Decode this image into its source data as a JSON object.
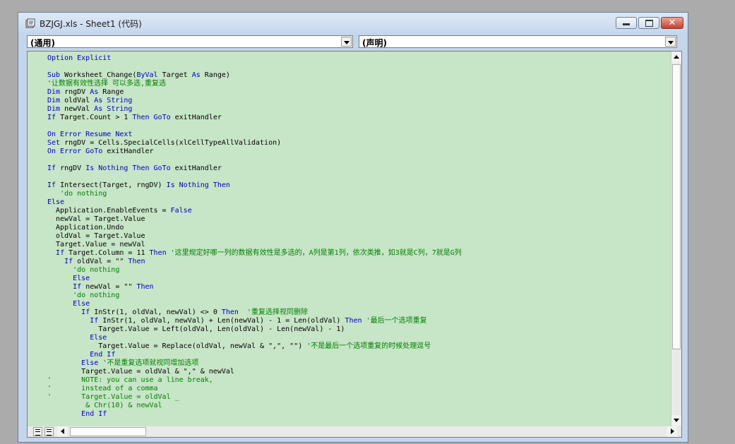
{
  "window": {
    "title": "BZJGJ.xls - Sheet1 (代码)",
    "buttons": {
      "minimize": "minimize-icon",
      "maximize": "maximize-icon",
      "close": "✕"
    }
  },
  "dropdowns": {
    "object": "(通用)",
    "procedure": "(声明)"
  },
  "colors": {
    "code_bg": "#c7e5c7",
    "keyword": "#0000c0",
    "comment": "#008000",
    "chrome": "#c4d6ec"
  },
  "code_lines": [
    [
      {
        "t": "Option Explicit",
        "c": "k"
      }
    ],
    [],
    [
      {
        "t": "Sub",
        "c": "k"
      },
      {
        "t": " Worksheet_Change("
      },
      {
        "t": "ByVal",
        "c": "k"
      },
      {
        "t": " Target "
      },
      {
        "t": "As",
        "c": "k"
      },
      {
        "t": " Range)"
      }
    ],
    [
      {
        "t": "'让数据有效性选择 可以多选,重复选",
        "c": "c"
      }
    ],
    [
      {
        "t": "Dim",
        "c": "k"
      },
      {
        "t": " rngDV "
      },
      {
        "t": "As",
        "c": "k"
      },
      {
        "t": " Range"
      }
    ],
    [
      {
        "t": "Dim",
        "c": "k"
      },
      {
        "t": " oldVal "
      },
      {
        "t": "As String",
        "c": "k"
      }
    ],
    [
      {
        "t": "Dim",
        "c": "k"
      },
      {
        "t": " newVal "
      },
      {
        "t": "As String",
        "c": "k"
      }
    ],
    [
      {
        "t": "If",
        "c": "k"
      },
      {
        "t": " Target.Count > 1 "
      },
      {
        "t": "Then GoTo",
        "c": "k"
      },
      {
        "t": " exitHandler"
      }
    ],
    [],
    [
      {
        "t": "On Error Resume Next",
        "c": "k"
      }
    ],
    [
      {
        "t": "Set",
        "c": "k"
      },
      {
        "t": " rngDV = Cells.SpecialCells(xlCellTypeAllValidation)"
      }
    ],
    [
      {
        "t": "On Error GoTo",
        "c": "k"
      },
      {
        "t": " exitHandler"
      }
    ],
    [],
    [
      {
        "t": "If",
        "c": "k"
      },
      {
        "t": " rngDV "
      },
      {
        "t": "Is Nothing Then GoTo",
        "c": "k"
      },
      {
        "t": " exitHandler"
      }
    ],
    [],
    [
      {
        "t": "If",
        "c": "k"
      },
      {
        "t": " Intersect(Target, rngDV) "
      },
      {
        "t": "Is Nothing Then",
        "c": "k"
      }
    ],
    [
      {
        "t": "   "
      },
      {
        "t": "'do nothing",
        "c": "c"
      }
    ],
    [
      {
        "t": "Else",
        "c": "k"
      }
    ],
    [
      {
        "t": "  Application.EnableEvents = "
      },
      {
        "t": "False",
        "c": "k"
      }
    ],
    [
      {
        "t": "  newVal = Target.Value"
      }
    ],
    [
      {
        "t": "  Application.Undo"
      }
    ],
    [
      {
        "t": "  oldVal = Target.Value"
      }
    ],
    [
      {
        "t": "  Target.Value = newVal"
      }
    ],
    [
      {
        "t": "  "
      },
      {
        "t": "If",
        "c": "k"
      },
      {
        "t": " Target.Column = 11 "
      },
      {
        "t": "Then",
        "c": "k"
      },
      {
        "t": " "
      },
      {
        "t": "'这里规定好哪一列的数据有效性是多选的，A列是第1列，依次类推，如3就是C列，7就是G列",
        "c": "c"
      }
    ],
    [
      {
        "t": "    "
      },
      {
        "t": "If",
        "c": "k"
      },
      {
        "t": " oldVal = \"\" "
      },
      {
        "t": "Then",
        "c": "k"
      }
    ],
    [
      {
        "t": "      "
      },
      {
        "t": "'do nothing",
        "c": "c"
      }
    ],
    [
      {
        "t": "      "
      },
      {
        "t": "Else",
        "c": "k"
      }
    ],
    [
      {
        "t": "      "
      },
      {
        "t": "If",
        "c": "k"
      },
      {
        "t": " newVal = \"\" "
      },
      {
        "t": "Then",
        "c": "k"
      }
    ],
    [
      {
        "t": "      "
      },
      {
        "t": "'do nothing",
        "c": "c"
      }
    ],
    [
      {
        "t": "      "
      },
      {
        "t": "Else",
        "c": "k"
      }
    ],
    [
      {
        "t": "        "
      },
      {
        "t": "If",
        "c": "k"
      },
      {
        "t": " InStr(1, oldVal, newVal) <> 0 "
      },
      {
        "t": "Then",
        "c": "k"
      },
      {
        "t": "  "
      },
      {
        "t": "'重复选择视同删除",
        "c": "c"
      }
    ],
    [
      {
        "t": "          "
      },
      {
        "t": "If",
        "c": "k"
      },
      {
        "t": " InStr(1, oldVal, newVal) + Len(newVal) - 1 = Len(oldVal) "
      },
      {
        "t": "Then",
        "c": "k"
      },
      {
        "t": " "
      },
      {
        "t": "'最后一个选项重复",
        "c": "c"
      }
    ],
    [
      {
        "t": "            Target.Value = Left(oldVal, Len(oldVal) - Len(newVal) - 1)"
      }
    ],
    [
      {
        "t": "          "
      },
      {
        "t": "Else",
        "c": "k"
      }
    ],
    [
      {
        "t": "            Target.Value = Replace(oldVal, newVal & \",\", \"\") "
      },
      {
        "t": "'不是最后一个选项重复的时候处理逗号",
        "c": "c"
      }
    ],
    [
      {
        "t": "          "
      },
      {
        "t": "End If",
        "c": "k"
      }
    ],
    [
      {
        "t": "        "
      },
      {
        "t": "Else",
        "c": "k"
      },
      {
        "t": " "
      },
      {
        "t": "'不是重复选项就视同增加选项",
        "c": "c"
      }
    ],
    [
      {
        "t": "        Target.Value = oldVal & \",\" & newVal"
      }
    ],
    [
      {
        "t": "'       NOTE: you can use a line break,",
        "c": "c"
      }
    ],
    [
      {
        "t": "'       instead of a comma",
        "c": "c"
      }
    ],
    [
      {
        "t": "'       Target.Value = oldVal _",
        "c": "c"
      }
    ],
    [
      {
        "t": "         & Chr(10) & newVal",
        "c": "c"
      }
    ],
    [
      {
        "t": "        "
      },
      {
        "t": "End If",
        "c": "k"
      }
    ]
  ]
}
